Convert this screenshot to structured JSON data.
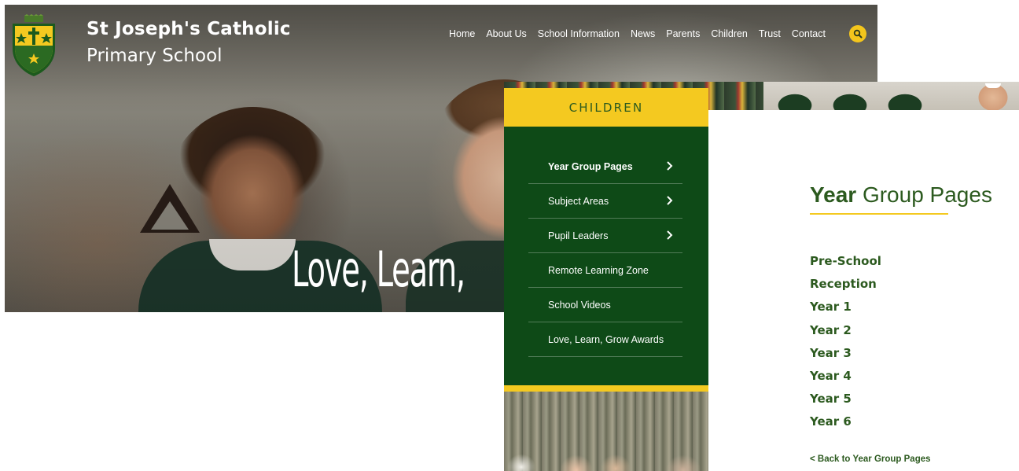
{
  "hero": {
    "school_name_line1": "St Joseph's Catholic",
    "school_name_line2": "Primary School",
    "nav": [
      "Home",
      "About Us",
      "School Information",
      "News",
      "Parents",
      "Children",
      "Trust",
      "Contact"
    ],
    "tagline": "Love, Learn,",
    "logo_icon": "school-crest-icon",
    "search_icon": "search-icon"
  },
  "sidebar": {
    "heading": "CHILDREN",
    "items": [
      {
        "label": "Year Group Pages",
        "has_submenu": true,
        "active": true
      },
      {
        "label": "Subject Areas",
        "has_submenu": true,
        "active": false
      },
      {
        "label": "Pupil Leaders",
        "has_submenu": true,
        "active": false
      },
      {
        "label": "Remote Learning Zone",
        "has_submenu": false,
        "active": false
      },
      {
        "label": "School Videos",
        "has_submenu": false,
        "active": false
      },
      {
        "label": "Love, Learn, Grow Awards",
        "has_submenu": false,
        "active": false
      }
    ]
  },
  "content": {
    "title_bold": "Year",
    "title_rest": " Group Pages",
    "year_groups": [
      "Pre-School",
      "Reception",
      "Year 1",
      "Year 2",
      "Year 3",
      "Year 4",
      "Year 5",
      "Year 6"
    ],
    "back_link": "< Back to Year Group Pages"
  },
  "colors": {
    "brand_green": "#0e4a17",
    "text_green": "#2c5a1f",
    "brand_yellow": "#f4c920"
  }
}
